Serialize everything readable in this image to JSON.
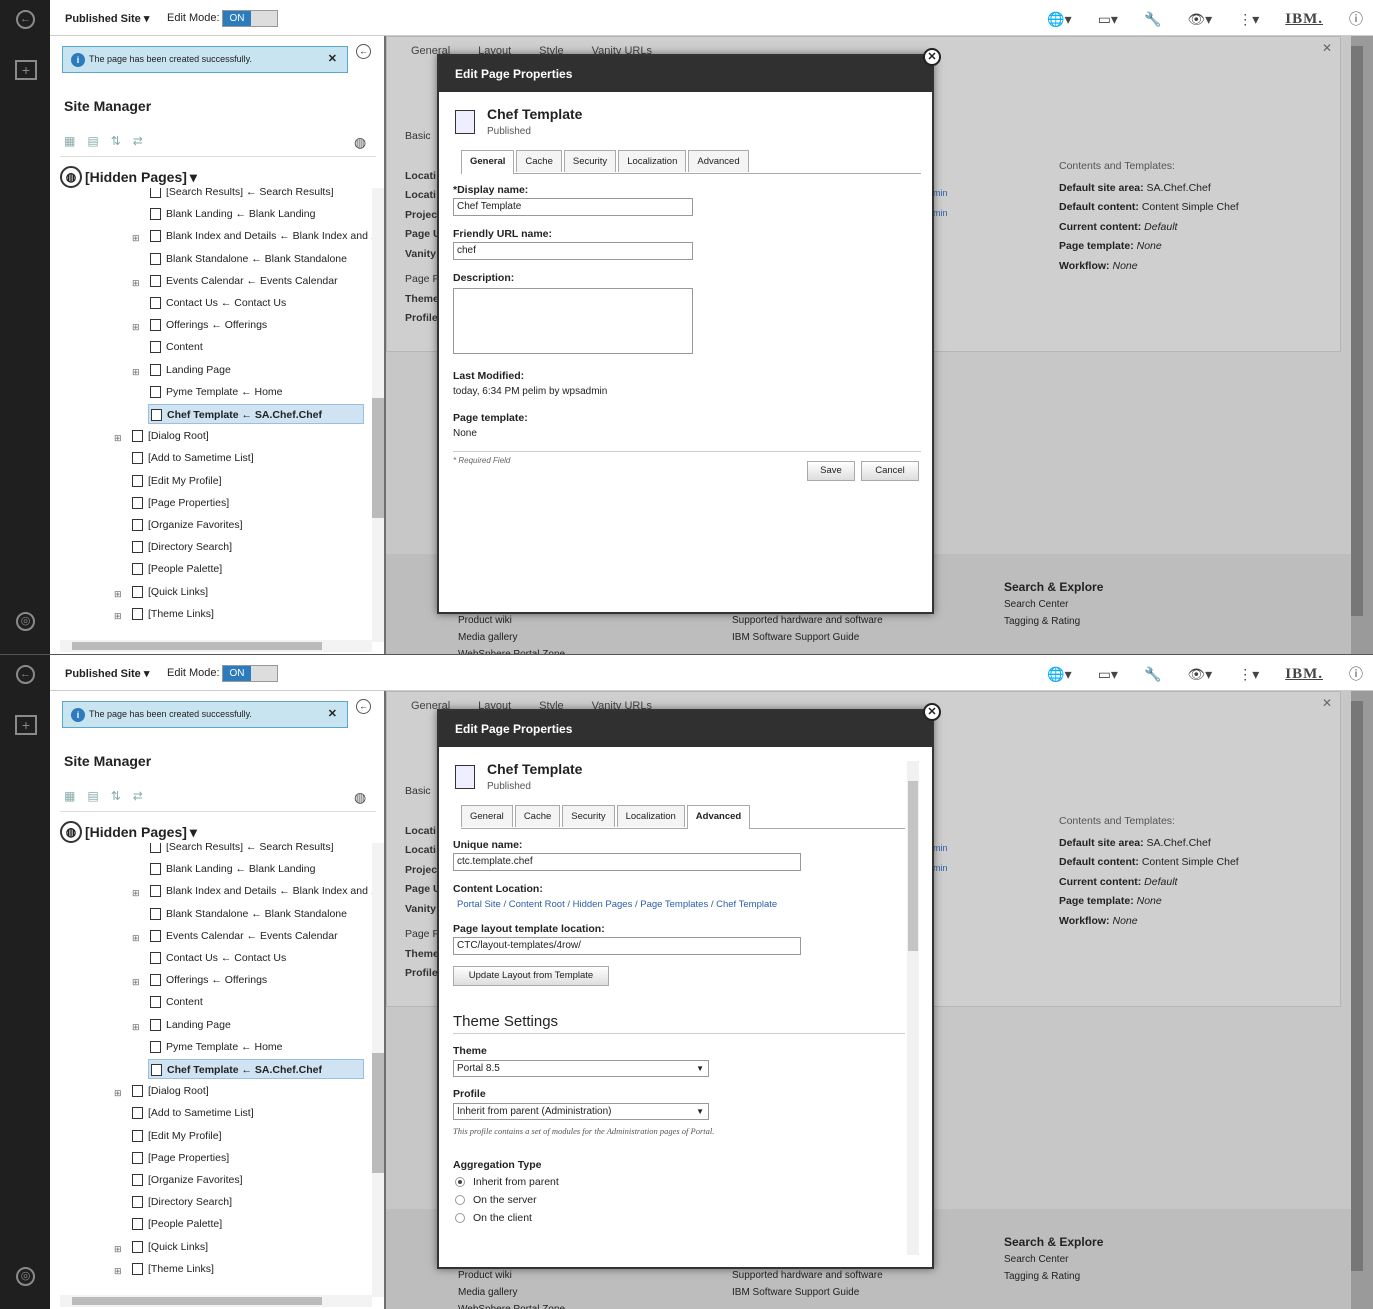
{
  "topbar": {
    "site_label": "Published Site ▾",
    "edit_mode_label": "Edit Mode:",
    "toggle_on": "ON",
    "ibm": "IBM."
  },
  "notification": {
    "text": "The page has been created successfully."
  },
  "site_manager": {
    "title": "Site Manager",
    "root": "[Hidden Pages]",
    "tree": [
      {
        "label": "[Search Results] ← Search Results]",
        "indent": 1
      },
      {
        "label": "Blank Landing ← Blank Landing",
        "indent": 1
      },
      {
        "label": "Blank Index and Details ← Blank Index and ...",
        "indent": 1,
        "expand": true
      },
      {
        "label": "Blank Standalone ← Blank Standalone",
        "indent": 1
      },
      {
        "label": "Events Calendar ← Events Calendar",
        "indent": 1,
        "expand": true
      },
      {
        "label": "Contact Us ← Contact Us",
        "indent": 1
      },
      {
        "label": "Offerings ← Offerings",
        "indent": 1,
        "expand": true
      },
      {
        "label": "Content",
        "indent": 1
      },
      {
        "label": "Landing Page",
        "indent": 1,
        "expand": true
      },
      {
        "label": "Pyme Template ← Home",
        "indent": 1
      },
      {
        "label": "Chef Template ← SA.Chef.Chef",
        "indent": 1,
        "selected": true
      },
      {
        "label": "[Dialog Root]",
        "indent": 0,
        "expand": true
      },
      {
        "label": "[Add to Sametime List]",
        "indent": 0
      },
      {
        "label": "[Edit My Profile]",
        "indent": 0
      },
      {
        "label": "[Page Properties]",
        "indent": 0
      },
      {
        "label": "[Organize Favorites]",
        "indent": 0
      },
      {
        "label": "[Directory Search]",
        "indent": 0
      },
      {
        "label": "[People Palette]",
        "indent": 0
      },
      {
        "label": "[Quick Links]",
        "indent": 0,
        "expand": true
      },
      {
        "label": "[Theme Links]",
        "indent": 0,
        "expand": true
      }
    ]
  },
  "content": {
    "tabs": [
      "General",
      "Layout",
      "Style",
      "Vanity URLs"
    ],
    "left_labels": [
      "Basic",
      "Locati",
      "Locati",
      "Projec",
      "Page U",
      "Vanity",
      "Page F",
      "Theme",
      "Profile"
    ],
    "right_heading": "Contents and Templates:",
    "right_rows": [
      {
        "k": "Default site area:",
        "v": "SA.Chef.Chef"
      },
      {
        "k": "Default content:",
        "v": "Content Simple Chef"
      },
      {
        "k": "Current content:",
        "v": "Default"
      },
      {
        "k": "Page template:",
        "v": "None"
      },
      {
        "k": "Workflow:",
        "v": "None"
      }
    ],
    "min_links": [
      "min",
      "min"
    ],
    "footer": {
      "heading": "Search & Explore",
      "col3": [
        "Search Center",
        "Tagging & Rating"
      ],
      "col1": [
        "Product wiki",
        "Media gallery",
        "WebSphere Portal Zone"
      ],
      "col2": [
        "Supported hardware and software",
        "IBM Software Support Guide"
      ]
    }
  },
  "modal": {
    "header": "Edit Page Properties",
    "page_title": "Chef Template",
    "page_status": "Published",
    "tabs": [
      "General",
      "Cache",
      "Security",
      "Localization",
      "Advanced"
    ],
    "general": {
      "display_name_label": "*Display name:",
      "display_name": "Chef Template",
      "friendly_url_label": "Friendly URL name:",
      "friendly_url": "chef",
      "description_label": "Description:",
      "last_modified_label": "Last Modified:",
      "last_modified": "today, 6:34 PM pelim  by wpsadmin",
      "page_template_label": "Page template:",
      "page_template": "None",
      "required_note": "* Required Field",
      "save": "Save",
      "cancel": "Cancel"
    },
    "advanced": {
      "unique_name_label": "Unique name:",
      "unique_name": "ctc.template.chef",
      "content_location_label": "Content Location:",
      "content_location": "Portal Site / Content Root / Hidden Pages / Page Templates / Chef Template",
      "layout_loc_label": "Page layout template location:",
      "layout_loc": "CTC/layout-templates/4row/",
      "update_btn": "Update Layout from Template",
      "theme_settings": "Theme Settings",
      "theme_label": "Theme",
      "theme_value": "Portal 8.5",
      "profile_label": "Profile",
      "profile_value": "Inherit from parent (Administration)",
      "profile_note": "This profile contains a set of modules for the Administration pages of Portal.",
      "aggregation_label": "Aggregation Type",
      "agg_options": [
        "Inherit from parent",
        "On the server",
        "On the client"
      ]
    }
  }
}
